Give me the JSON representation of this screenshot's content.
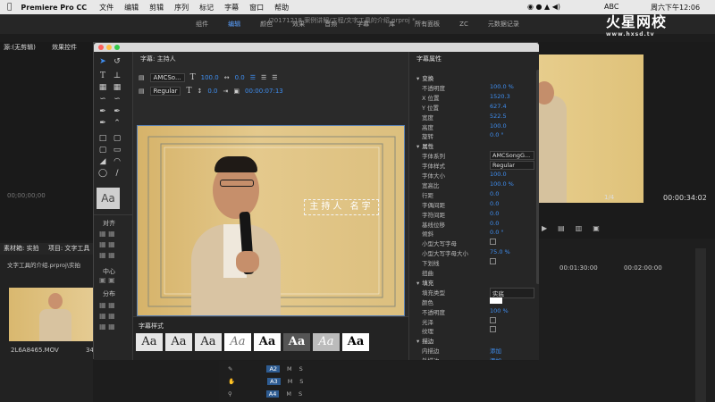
{
  "menubar": {
    "app_name": "Premiere Pro CC",
    "items": [
      "文件",
      "编辑",
      "剪辑",
      "序列",
      "标记",
      "字幕",
      "窗口",
      "帮助"
    ],
    "status_abc": "ABC",
    "clock": "周六下午12:06"
  },
  "workspace": {
    "tabs": [
      "组件",
      "编辑",
      "颜色",
      "效果",
      "音频",
      "字幕",
      "库",
      "所有面板",
      "ZC",
      "元数据记录"
    ],
    "active_index": 1,
    "path": "/20171218 案例讲解/工程/文字工具的介绍.prproj *"
  },
  "watermark": {
    "brand": "火星网校",
    "url": "www.hxsd.tv"
  },
  "source_panel": {
    "tab1": "源:(无剪辑)",
    "tab2": "效果控件",
    "timecode": "00;00;00;00"
  },
  "project_panel": {
    "tab1": "素材箱: 实拍",
    "tab2": "项目: 文字工具",
    "breadcrumb": "文字工具的介绍.prproj\\实拍",
    "clip_name": "2L6A8465.MOV",
    "clip_duration": "34"
  },
  "titler": {
    "title_label": "字幕: 主持人",
    "font_family": "AMCSo...",
    "font_style": "Regular",
    "font_size": "100.0",
    "kerning": "0.0",
    "leading": "0.0",
    "timecode": "00:00:07:13",
    "align_label": "对齐",
    "center_label": "中心",
    "distribute_label": "分布",
    "styles_title": "字幕样式",
    "styles": [
      "Aa",
      "Aa",
      "Aa",
      "Aa",
      "Aa",
      "Aa",
      "Aa",
      "Aa"
    ],
    "caption_text": "主持人 名字"
  },
  "properties": {
    "title": "字幕属性",
    "rows": [
      {
        "label": "变换",
        "value": ""
      },
      {
        "label": "不透明度",
        "value": "100.0 %"
      },
      {
        "label": "X 位置",
        "value": "1520.3"
      },
      {
        "label": "Y 位置",
        "value": "627.4"
      },
      {
        "label": "宽度",
        "value": "522.5"
      },
      {
        "label": "高度",
        "value": "100.0"
      },
      {
        "label": "旋转",
        "value": "0.0 °"
      },
      {
        "label": "属性",
        "value": ""
      },
      {
        "label": "字体系列",
        "value": "AMCSongG..."
      },
      {
        "label": "字体样式",
        "value": "Regular"
      },
      {
        "label": "字体大小",
        "value": "100.0"
      },
      {
        "label": "宽高比",
        "value": "100.0 %"
      },
      {
        "label": "行距",
        "value": "0.0"
      },
      {
        "label": "字偶间距",
        "value": "0.0"
      },
      {
        "label": "字符间距",
        "value": "0.0"
      },
      {
        "label": "基线位移",
        "value": "0.0"
      },
      {
        "label": "倾斜",
        "value": "0.0 °"
      },
      {
        "label": "小型大写字母",
        "value": ""
      },
      {
        "label": "小型大写字母大小",
        "value": "75.0 %"
      },
      {
        "label": "下划线",
        "value": ""
      },
      {
        "label": "扭曲",
        "value": ""
      },
      {
        "label": "填充",
        "value": ""
      },
      {
        "label": "填充类型",
        "value": "实底"
      },
      {
        "label": "颜色",
        "value": ""
      },
      {
        "label": "不透明度",
        "value": "100 %"
      },
      {
        "label": "光泽",
        "value": ""
      },
      {
        "label": "纹理",
        "value": ""
      },
      {
        "label": "描边",
        "value": ""
      },
      {
        "label": "内描边",
        "value": "添加"
      },
      {
        "label": "外描边",
        "value": "添加"
      }
    ]
  },
  "program_panel": {
    "zoom": "1/4",
    "timecode": "00:00:34:02"
  },
  "timeline": {
    "ruler": [
      "00:01:30:00",
      "00:02:00:00"
    ],
    "tracks": [
      "A2",
      "A3",
      "A4"
    ],
    "toggles": [
      "M",
      "S"
    ]
  },
  "colors": {
    "accent": "#3f8ef0",
    "panel": "#232323",
    "titlebar": "#d9d9d9"
  }
}
